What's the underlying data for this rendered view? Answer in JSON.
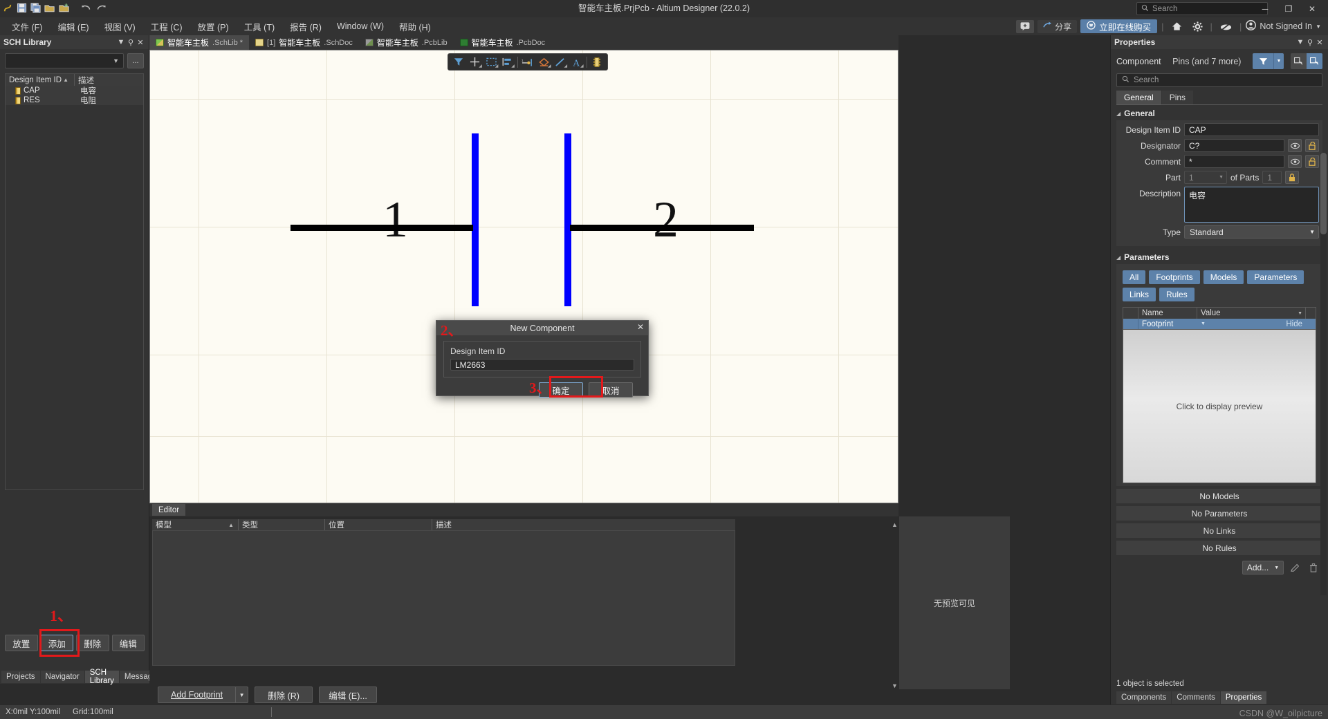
{
  "titlebar": {
    "title": "智能车主板.PrjPcb - Altium Designer (22.0.2)",
    "search_placeholder": "Search",
    "minimize": "─",
    "restore": "❐",
    "close": "✕"
  },
  "menubar": {
    "items": [
      {
        "label": "文件 (F)"
      },
      {
        "label": "编辑 (E)"
      },
      {
        "label": "视图 (V)"
      },
      {
        "label": "工程 (C)"
      },
      {
        "label": "放置 (P)"
      },
      {
        "label": "工具 (T)"
      },
      {
        "label": "报告 (R)"
      },
      {
        "label": "Window (W)"
      },
      {
        "label": "帮助 (H)"
      }
    ],
    "right": {
      "notes_icon": "🗨",
      "share_label": "分享",
      "buy_label": "立即在线购买",
      "home_icon": "⌂",
      "gear_icon": "✸",
      "cloud_icon": "◍",
      "account_label": "Not Signed In"
    }
  },
  "quickaccess": {
    "icons": [
      "altium-logo",
      "save-icon",
      "save-all-icon",
      "open-icon",
      "open-project-icon",
      "undo-icon",
      "redo-icon"
    ]
  },
  "sch_library": {
    "panel_title": "SCH Library",
    "filter_value": "",
    "ellipsis_label": "...",
    "columns": [
      "Design Item ID",
      "描述"
    ],
    "rows": [
      {
        "id": "CAP",
        "desc": "电容"
      },
      {
        "id": "RES",
        "desc": "电阻"
      }
    ],
    "buttons": [
      {
        "label": "放置"
      },
      {
        "label": "添加"
      },
      {
        "label": "删除"
      },
      {
        "label": "编辑"
      }
    ],
    "bottom_tabs": [
      {
        "label": "Projects"
      },
      {
        "label": "Navigator"
      },
      {
        "label": "SCH Library"
      },
      {
        "label": "Messages"
      }
    ],
    "active_bottom_tab": "SCH Library"
  },
  "annotations": {
    "step1": "1、",
    "step2": "2、",
    "step3": "3、"
  },
  "doc_tabs": [
    {
      "name": "智能车主板",
      "ext": ".SchLib *",
      "prefix": "",
      "icon": "schlib-icon",
      "active": true
    },
    {
      "name": "智能车主板",
      "ext": ".SchDoc",
      "prefix": "[1] ",
      "icon": "schdoc-icon",
      "active": false
    },
    {
      "name": "智能车主板",
      "ext": ".PcbLib",
      "prefix": "",
      "icon": "pcblib-icon",
      "active": false
    },
    {
      "name": "智能车主板",
      "ext": ".PcbDoc",
      "prefix": "",
      "icon": "pcbdoc-icon",
      "active": false
    }
  ],
  "sch_toolbar": {
    "tools": [
      {
        "icon": "filter-icon",
        "name": "filter-tool"
      },
      {
        "icon": "crosshair-icon",
        "name": "place-tool"
      },
      {
        "icon": "rectangle-select-icon",
        "name": "rectangle-tool"
      },
      {
        "icon": "align-icon",
        "name": "align-tool"
      },
      {
        "icon": "pin-icon",
        "name": "place-pin-tool"
      },
      {
        "icon": "polygon-icon",
        "name": "place-polygon-tool"
      },
      {
        "icon": "line-icon",
        "name": "place-line-tool"
      },
      {
        "icon": "text-icon",
        "name": "place-text-tool"
      },
      {
        "icon": "component-icon",
        "name": "place-component-tool"
      }
    ]
  },
  "canvas": {
    "pin_labels": [
      "1",
      "2"
    ]
  },
  "dialog": {
    "title": "New Component",
    "close_icon": "✕",
    "field_label": "Design Item ID",
    "field_value": "LM2663",
    "ok_label": "确定",
    "cancel_label": "取消"
  },
  "editor_panel": {
    "tab_label": "Editor",
    "columns": [
      "模型",
      "类型",
      "位置",
      "描述"
    ],
    "rows": [],
    "preview_text": "无预览可见"
  },
  "footprint_bar": {
    "add_footprint": "Add Footprint",
    "delete": "删除 (R)",
    "edit": "编辑 (E)..."
  },
  "properties": {
    "panel_title": "Properties",
    "object_kind": "Component",
    "object_sub": "Pins (and 7 more)",
    "search_placeholder": "Search",
    "tabs": [
      {
        "label": "General",
        "active": true
      },
      {
        "label": "Pins",
        "active": false
      }
    ],
    "general": {
      "section_title": "General",
      "design_item_id_label": "Design Item ID",
      "design_item_id_value": "CAP",
      "designator_label": "Designator",
      "designator_value": "C?",
      "comment_label": "Comment",
      "comment_value": "*",
      "part_label": "Part",
      "part_value": "1",
      "of_parts_label": "of Parts",
      "of_parts_value": "1",
      "description_label": "Description",
      "description_value": "电容",
      "type_label": "Type",
      "type_value": "Standard"
    },
    "parameters": {
      "section_title": "Parameters",
      "chips": [
        "All",
        "Footprints",
        "Models",
        "Parameters",
        "Links",
        "Rules"
      ],
      "columns": [
        "Name",
        "Value"
      ],
      "rows": [
        {
          "name": "Footprint",
          "value": "",
          "hide": "Hide"
        }
      ],
      "preview_text": "Click to display preview",
      "empty_states": [
        "No Models",
        "No Parameters",
        "No Links",
        "No Rules"
      ],
      "add_label": "Add...",
      "edit_icon": "✎",
      "delete_icon": "🗑"
    },
    "status": "1 object is selected",
    "bottom_tabs": [
      {
        "label": "Components"
      },
      {
        "label": "Comments"
      },
      {
        "label": "Properties",
        "active": true
      }
    ]
  },
  "statusbar": {
    "coords": "X:0mil Y:100mil",
    "grid": "Grid:100mil",
    "watermark": "CSDN @W_oilpicture"
  },
  "colors": {
    "accent_blue": "#5d82aa",
    "annotation_red": "#e2191b",
    "panel_bg": "#333333",
    "canvas_bg": "#fdfbf3",
    "pin_blue": "#0000ff"
  }
}
